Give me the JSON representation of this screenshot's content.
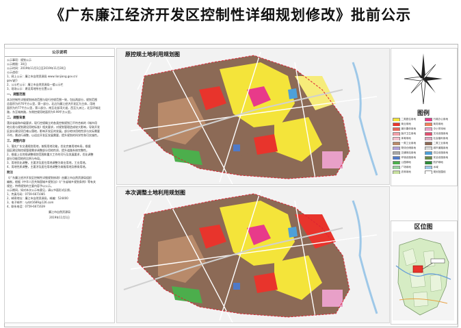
{
  "page": {
    "title": "《广东廉江经济开发区控制性详细规划修改》批前公示"
  },
  "notice": {
    "heading": "公示说明",
    "lines": [
      "公示事项：规划公示",
      "公示期限：30日",
      "公示时间：2019年11月1日至2019年11月30日",
      "公示途径：",
      "1、网上公示：廉江市自然资源局 www.lianjiang.gov.cn/",
      "gov/gt/）",
      "2、公示栏公示：廉江市自然资源局一楼公示栏",
      "3、现场公示：建设用地所在位置公示"
    ],
    "sec1_title": "一、调整范围",
    "sec1_lines": [
      "本次控制性详细规划修改范围与现行控规范围一致，包括两部分，规划范围",
      "总面积为约76平方公里，第一部分，北边为廉江经济开发区为主体，用地",
      "面积为约77平方公里，第二部分，南至北部湾大道，西至九洲江，北至环城北",
      "路，东至城南路，东侧控规用地面积为9.99平方公里。"
    ],
    "sec2_title": "二、调整背景",
    "sec2_lines": [
      "落实省级和市级要求，现行控规确立的各类控制规划已不符合新的《城市用",
      "地分类与规划建设用地标准》相关要求，对规划管理造成较大影响，导致开发",
      "区部分建设项目难以落地，影响开发区的发展。部分地块用地性质与实际需要",
      "不符，需进行调整，以适应开发区发展需要，提升规划的科学性和可实施性。"
    ],
    "sec3_title": "三、调整内容",
    "sec3_lines": [
      "1、落实广东交通规划用地，按照用地功能，优化完善用地布局，根据",
      "园区建设和控规管理需求调整部分用地性质，提升道路系统完整性。",
      "2、根据上位控规调整规划范围和重大工作的可行及发展要求，优化调整",
      "部分功能用地的比例与布局。",
      "3、用地优化调整，主要涉及居住用地调整为商业用地，工业用地。",
      "4、用地性质调整，主要涉及居住用地调整为商服用地及教育用地。"
    ],
    "sec4_title": "附注",
    "sec4_lines": [
      "《广东廉江经济开发区控制性详细规划修改》由廉江市自然资源局组织",
      "编制，根据《中华人民共和国城乡规划法》《广东省城乡规划条例》等有关",
      "规定，特将规划的主要内容予以公示。",
      "公示期间，如对本次公示有意见，请以书面形式反馈，",
      "1、传真号码：0759-6671085",
      "2、邮寄地址：廉江市自然资源局，邮编：524400",
      "3、电子邮件：rydzt1689@126.com",
      "4、联系电话：0759-6671639"
    ],
    "foot_org": "廉江市自然资源局",
    "foot_date": "2019年11月1日"
  },
  "panels": {
    "original_title": "原控规土地利用规划图",
    "revised_title": "本次调整土地利用规划图"
  },
  "legend": {
    "title": "图例",
    "items": [
      {
        "label": "二类居住用地",
        "color": "#f4e43a"
      },
      {
        "label": "行政办公用地",
        "color": "#e83a8a"
      },
      {
        "label": "商业用地",
        "color": "#e8342c"
      },
      {
        "label": "商务用地",
        "color": "#f27f5a"
      },
      {
        "label": "娱乐康体用地",
        "color": "#e8675a"
      },
      {
        "label": "中小学用地",
        "color": "#e8a0c8"
      },
      {
        "label": "医疗卫生用地",
        "color": "#f0a0a8"
      },
      {
        "label": "文化设施用地",
        "color": "#e05070"
      },
      {
        "label": "体育用地",
        "color": "#f2c0cc"
      },
      {
        "label": "社会福利用地",
        "color": "#d8a8c0"
      },
      {
        "label": "一类工业用地",
        "color": "#b88a6a"
      },
      {
        "label": "二类工业用地",
        "color": "#8c6a56"
      },
      {
        "label": "物流仓储用地",
        "color": "#b0a0d8"
      },
      {
        "label": "城市道路用地",
        "color": "#d8d8d8"
      },
      {
        "label": "交通场站用地",
        "color": "#a8a8a8"
      },
      {
        "label": "供应设施用地",
        "color": "#4ea0d8"
      },
      {
        "label": "环境设施用地",
        "color": "#4f7ac8"
      },
      {
        "label": "安全设施用地",
        "color": "#6a8a4a"
      },
      {
        "label": "公园绿地",
        "color": "#4cae4c"
      },
      {
        "label": "防护绿地",
        "color": "#2f8a3a"
      },
      {
        "label": "广场用地",
        "color": "#9ad0a0"
      },
      {
        "label": "水域",
        "color": "#9ec8e8"
      },
      {
        "label": "农林用地",
        "color": "#c8e0a0"
      },
      {
        "label": "规划范围线",
        "color": "#ffffff"
      }
    ]
  },
  "location": {
    "title": "区位图"
  }
}
